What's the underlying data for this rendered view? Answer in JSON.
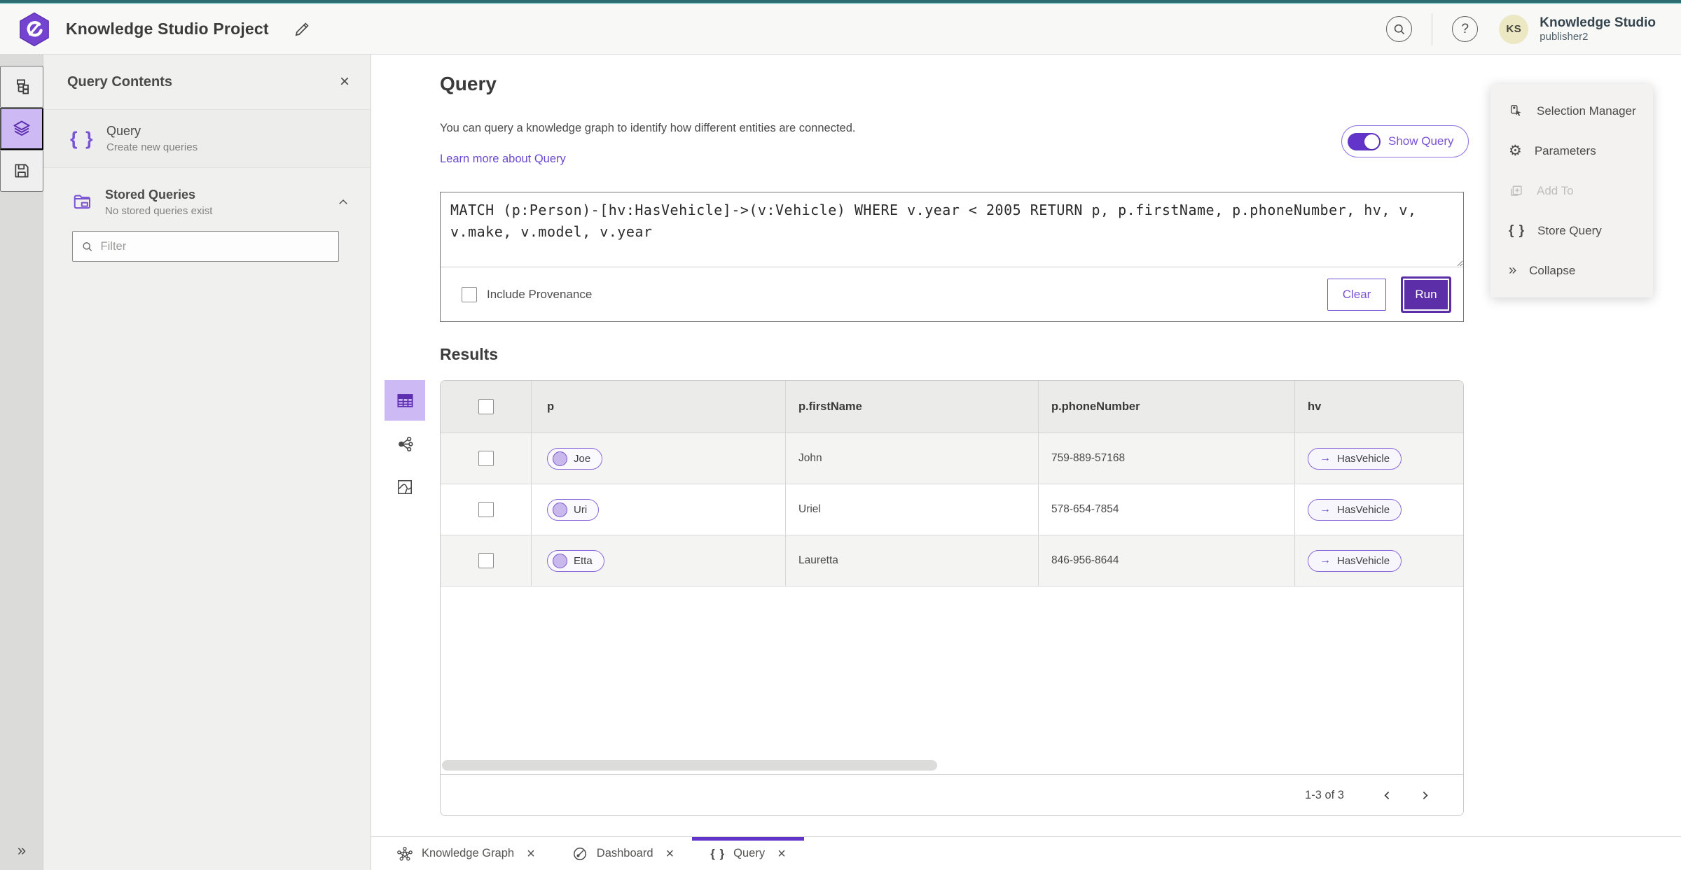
{
  "header": {
    "title": "Knowledge Studio Project",
    "user": {
      "initials": "KS",
      "org": "Knowledge Studio",
      "name": "publisher2"
    }
  },
  "icon_strip": {
    "items": [
      {
        "icon": "hierarchy-icon",
        "active": false
      },
      {
        "icon": "layers-icon",
        "active": true
      },
      {
        "icon": "save-icon",
        "active": false
      }
    ],
    "expand_icon": "chevron-double-right-icon",
    "expand_glyph": "»"
  },
  "sidebar": {
    "title": "Query Contents",
    "query_item": {
      "icon": "braces-icon",
      "glyph": "{ }",
      "title": "Query",
      "subtitle": "Create new queries"
    },
    "stored_queries": {
      "icon": "folder-icon",
      "title": "Stored Queries",
      "subtitle": "No stored queries exist",
      "expanded": true
    },
    "filter": {
      "placeholder": "Filter"
    }
  },
  "query": {
    "heading": "Query",
    "description": "You can query a knowledge graph to identify how different entities are connected.",
    "learn_more_label": "Learn more about Query",
    "show_query_label": "Show Query",
    "show_query_on": true,
    "text": "MATCH (p:Person)-[hv:HasVehicle]->(v:Vehicle) WHERE v.year < 2005 RETURN p, p.firstName, p.phoneNumber, hv, v, v.make, v.model, v.year",
    "include_provenance_label": "Include Provenance",
    "include_provenance_checked": false,
    "clear_label": "Clear",
    "run_label": "Run"
  },
  "results": {
    "heading": "Results",
    "view_icons": [
      "table-view-icon",
      "link-chart-view-icon",
      "map-view-icon"
    ],
    "columns": [
      "p",
      "p.firstName",
      "p.phoneNumber",
      "hv"
    ],
    "rows": [
      {
        "p": "Joe",
        "p_firstName": "John",
        "p_phoneNumber": "759-889-57168",
        "hv": "HasVehicle"
      },
      {
        "p": "Uri",
        "p_firstName": "Uriel",
        "p_phoneNumber": "578-654-7854",
        "hv": "HasVehicle"
      },
      {
        "p": "Etta",
        "p_firstName": "Lauretta",
        "p_phoneNumber": "846-956-8644",
        "hv": "HasVehicle"
      }
    ],
    "edge_arrow_glyph": "→",
    "pagination": {
      "range_label": "1-3 of 3"
    }
  },
  "actions_panel": {
    "items": [
      {
        "icon": "selection-manager-icon",
        "label": "Selection Manager",
        "disabled": false
      },
      {
        "icon": "gear-icon",
        "glyph": "⚙",
        "label": "Parameters",
        "disabled": false
      },
      {
        "icon": "add-to-icon",
        "label": "Add To",
        "disabled": true
      },
      {
        "icon": "braces-icon",
        "glyph": "{ }",
        "label": "Store Query",
        "disabled": false
      },
      {
        "icon": "collapse-icon",
        "glyph": "»",
        "label": "Collapse",
        "disabled": false
      }
    ]
  },
  "tabs": [
    {
      "icon": "knowledge-graph-icon",
      "label": "Knowledge Graph",
      "close_glyph": "×",
      "active": false
    },
    {
      "icon": "dashboard-icon",
      "label": "Dashboard",
      "close_glyph": "×",
      "active": false
    },
    {
      "icon": "braces-icon",
      "glyph": "{ }",
      "label": "Query",
      "close_glyph": "×",
      "active": true
    }
  ],
  "colors": {
    "accent_purple": "#6334c9",
    "accent_purple_dark": "#5c2fa8",
    "accent_purple_light": "#cdb9f4",
    "purple_text": "#7a52d4",
    "teal_top": "#2c6b70",
    "chip_border": "#8a68d8",
    "chip_node_fill": "#c9b8ec",
    "avatar_bg": "#ece8c4"
  }
}
